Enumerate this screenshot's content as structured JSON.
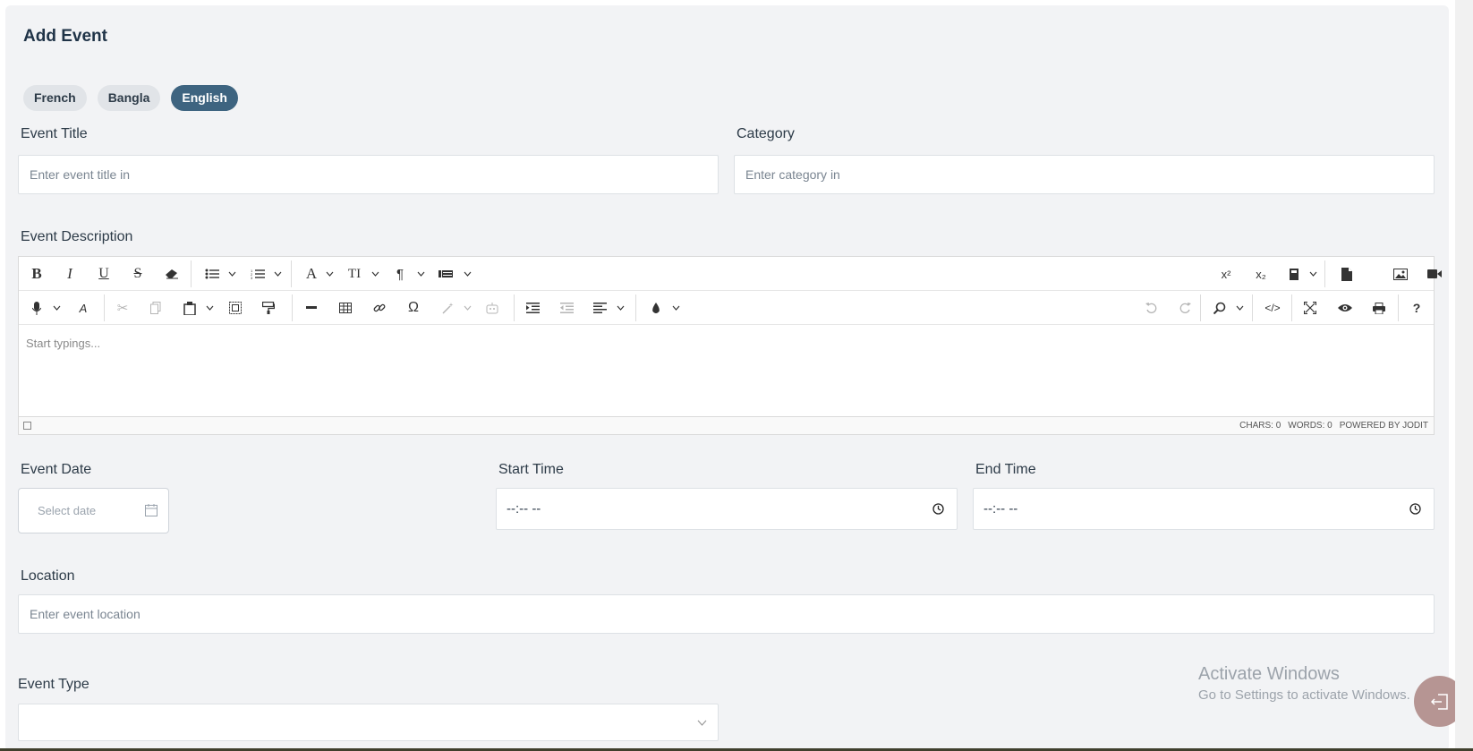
{
  "page": {
    "title": "Add Event"
  },
  "languages": [
    {
      "label": "French",
      "active": false
    },
    {
      "label": "Bangla",
      "active": false
    },
    {
      "label": "English",
      "active": true
    }
  ],
  "event_title": {
    "label": "Event Title",
    "placeholder": "Enter event title in"
  },
  "category": {
    "label": "Category",
    "placeholder": "Enter category in"
  },
  "description": {
    "label": "Event Description",
    "placeholder": "Start typings...",
    "status": {
      "chars": "CHARS: 0",
      "words": "WORDS: 0",
      "powered": "POWERED BY JODIT"
    }
  },
  "event_date": {
    "label": "Event Date",
    "placeholder": "Select date"
  },
  "start_time": {
    "label": "Start Time",
    "value": "--:-- --"
  },
  "end_time": {
    "label": "End Time",
    "value": "--:-- --"
  },
  "location": {
    "label": "Location",
    "placeholder": "Enter event location"
  },
  "event_type": {
    "label": "Event Type",
    "value": ""
  },
  "watermark": {
    "title": "Activate Windows",
    "subtitle": "Go to Settings to activate Windows."
  },
  "colors": {
    "accent": "#3e6480",
    "card_bg": "#f2f3f5",
    "fab": "#b69593"
  }
}
